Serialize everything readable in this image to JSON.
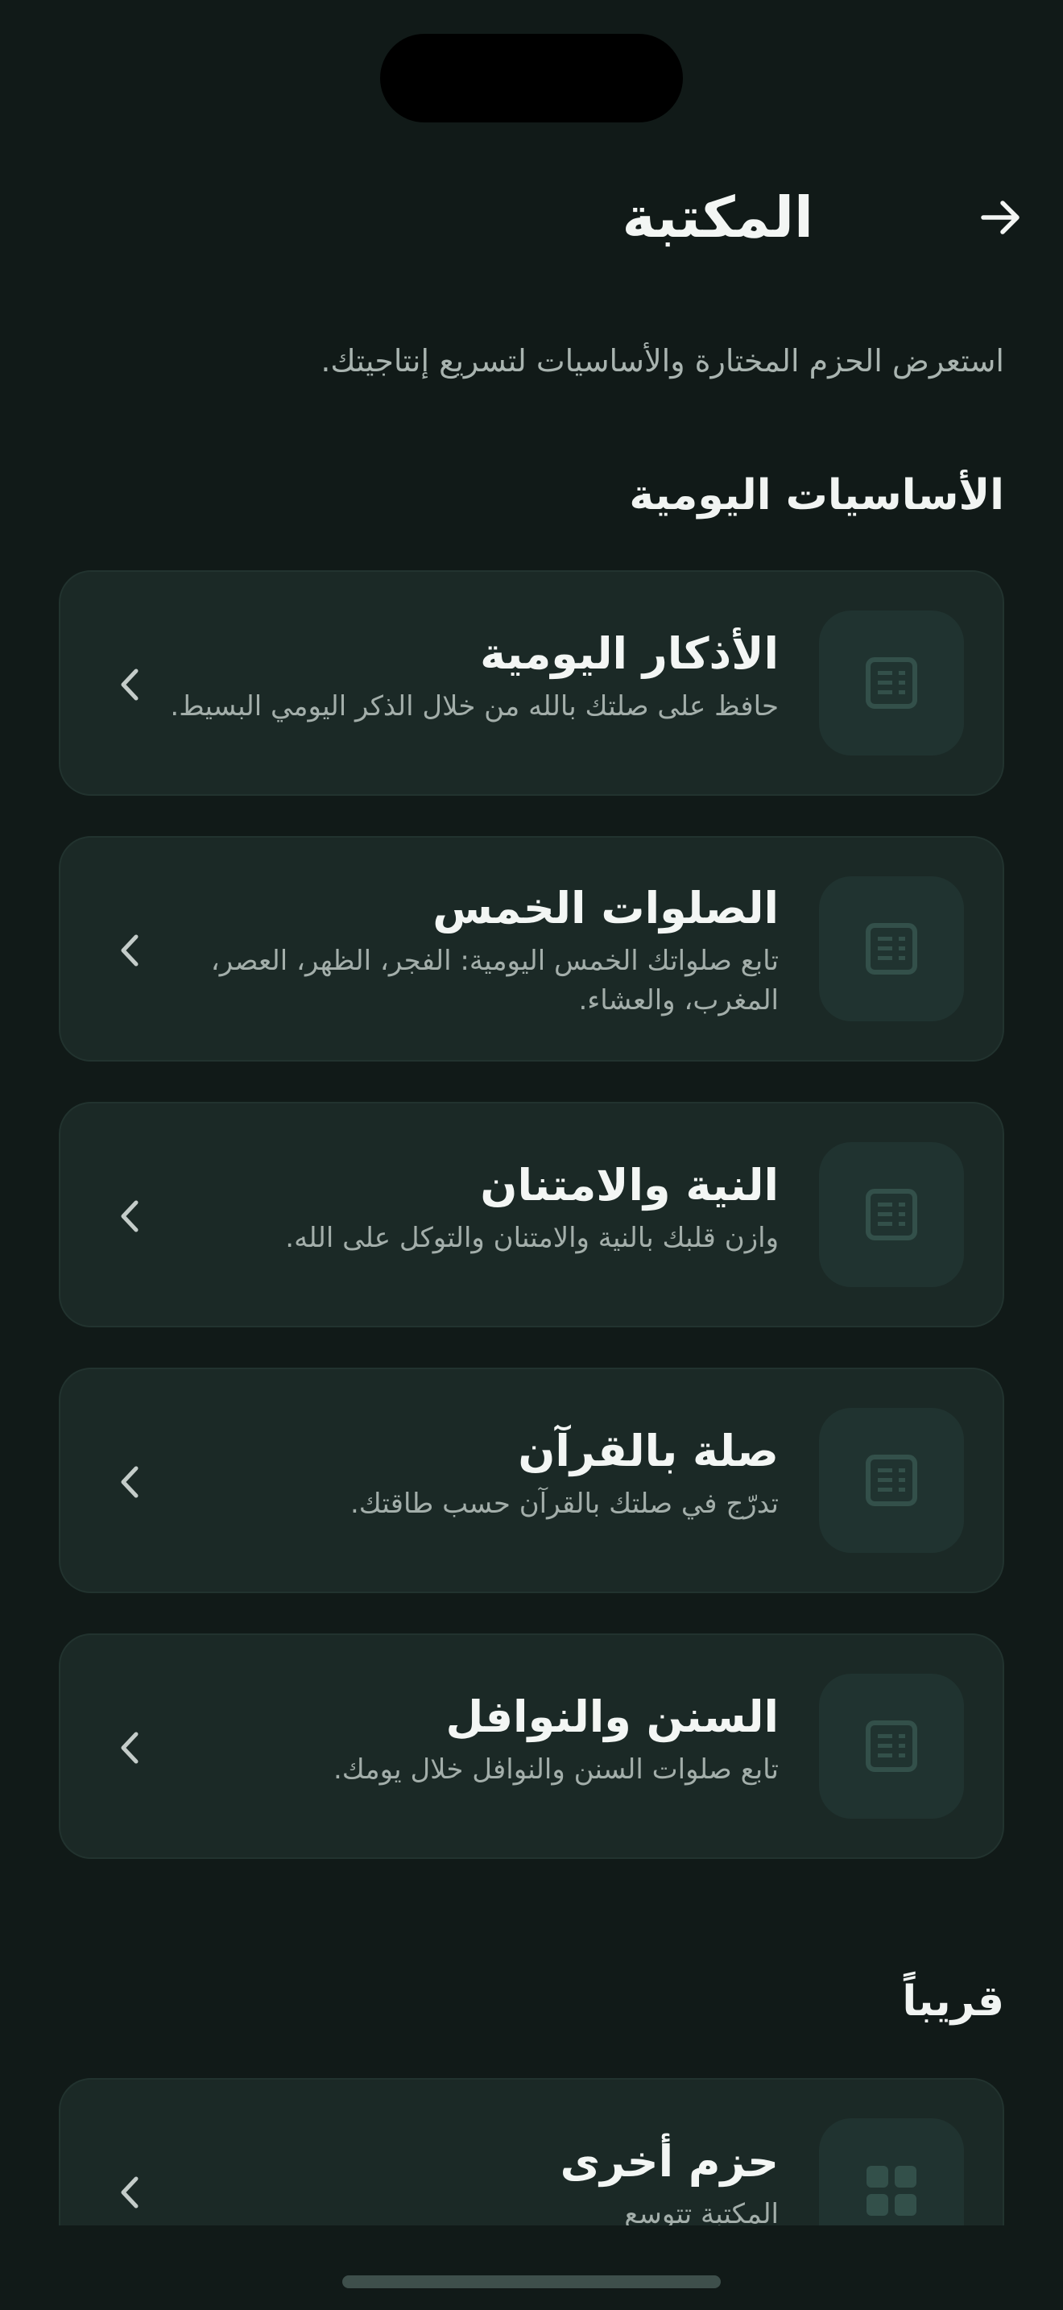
{
  "header": {
    "title": "المكتبة",
    "back_icon": "arrow-right-icon"
  },
  "subtitle": "استعرض الحزم المختارة والأساسيات لتسريع إنتاجيتك.",
  "sections": {
    "daily": {
      "heading": "الأساسيات اليومية",
      "items": [
        {
          "title": "الأذكار اليومية",
          "desc": "حافظ على صلتك بالله من خلال الذكر اليومي البسيط.",
          "icon": "list-document-icon"
        },
        {
          "title": "الصلوات الخمس",
          "desc": "تابع صلواتك الخمس اليومية: الفجر، الظهر، العصر، المغرب، والعشاء.",
          "icon": "list-document-icon"
        },
        {
          "title": "النية والامتنان",
          "desc": "وازن قلبك بالنية والامتنان والتوكل على الله.",
          "icon": "list-document-icon"
        },
        {
          "title": "صلة بالقرآن",
          "desc": "تدرّج في صلتك بالقرآن حسب طاقتك.",
          "icon": "list-document-icon"
        },
        {
          "title": "السنن والنوافل",
          "desc": "تابع صلوات السنن والنوافل خلال يومك.",
          "icon": "list-document-icon"
        }
      ]
    },
    "soon": {
      "heading": "قريباً",
      "items": [
        {
          "title": "حزم أخرى",
          "desc": "المكتبة تتوسع",
          "icon": "grid-icon"
        }
      ]
    }
  },
  "colors": {
    "background": "#111a18",
    "card": "#1b2926",
    "icon_box": "#203330",
    "icon": "#33504a",
    "text_primary": "#f3f6f4",
    "text_secondary": "#a3aeaa"
  }
}
